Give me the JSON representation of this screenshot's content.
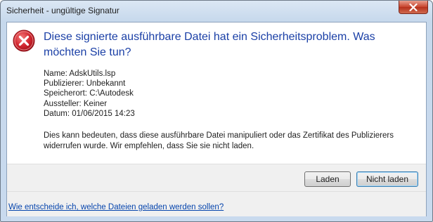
{
  "window": {
    "title": "Sicherheit - ungültige Signatur"
  },
  "dialog": {
    "icon": "error-icon",
    "headline": "Diese signierte ausführbare Datei hat ein Sicherheitsproblem.  Was möchten Sie tun?",
    "details": [
      "Name: AdskUtils.lsp",
      "Publizierer: Unbekannt",
      "Speicherort: C:\\Autodesk",
      "Aussteller: Keiner",
      "Datum: 01/06/2015  14:23"
    ],
    "warning": "Dies kann bedeuten, dass diese ausführbare Datei manipuliert oder das Zertifikat des Publizierers widerrufen wurde. Wir empfehlen, dass Sie sie nicht laden."
  },
  "buttons": {
    "load_label": "Laden",
    "no_load_label": "Nicht laden"
  },
  "footer": {
    "help_link": "Wie entscheide ich, welche Dateien geladen werden sollen?"
  },
  "colors": {
    "headline": "#1a3fa6",
    "link": "#0645ad",
    "error_red": "#c8202c",
    "close_button": "#c7432c"
  }
}
